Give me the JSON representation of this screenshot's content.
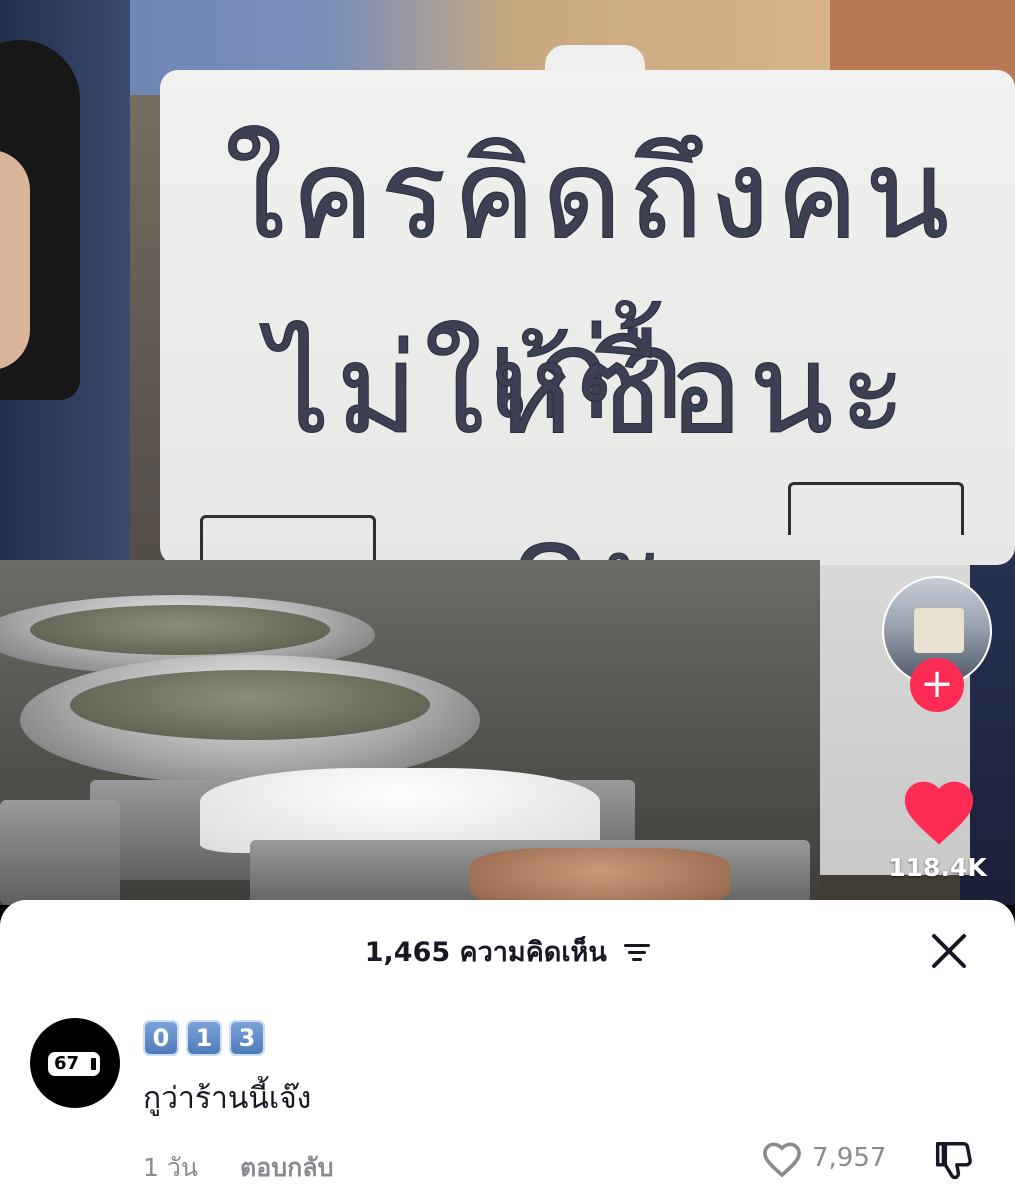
{
  "video": {
    "sign_line1": "ใครคิดถึงคนเก่า",
    "sign_line2": "ไม่ให้ซื้อนะคะ"
  },
  "rail": {
    "follow_symbol": "+",
    "like_count": "118.4K",
    "icons": [
      "profile-avatar",
      "plus-icon",
      "heart-icon"
    ]
  },
  "comments": {
    "header": "1,465 ความคิดเห็น",
    "sort_icon": "sort-icon",
    "close_icon": "close-icon"
  },
  "comment": {
    "avatar_badge": "67",
    "username_keys": [
      "0",
      "1",
      "3"
    ],
    "text": "กูว่าร้านนี้เจ๊ง",
    "time": "1 วัน",
    "reply_label": "ตอบกลับ",
    "like_count": "7,957",
    "icons": [
      "heart-outline-icon",
      "dislike-icon"
    ]
  },
  "colors": {
    "accent": "#fe2c55",
    "text_primary": "#161823",
    "text_secondary": "#8a8b91"
  }
}
